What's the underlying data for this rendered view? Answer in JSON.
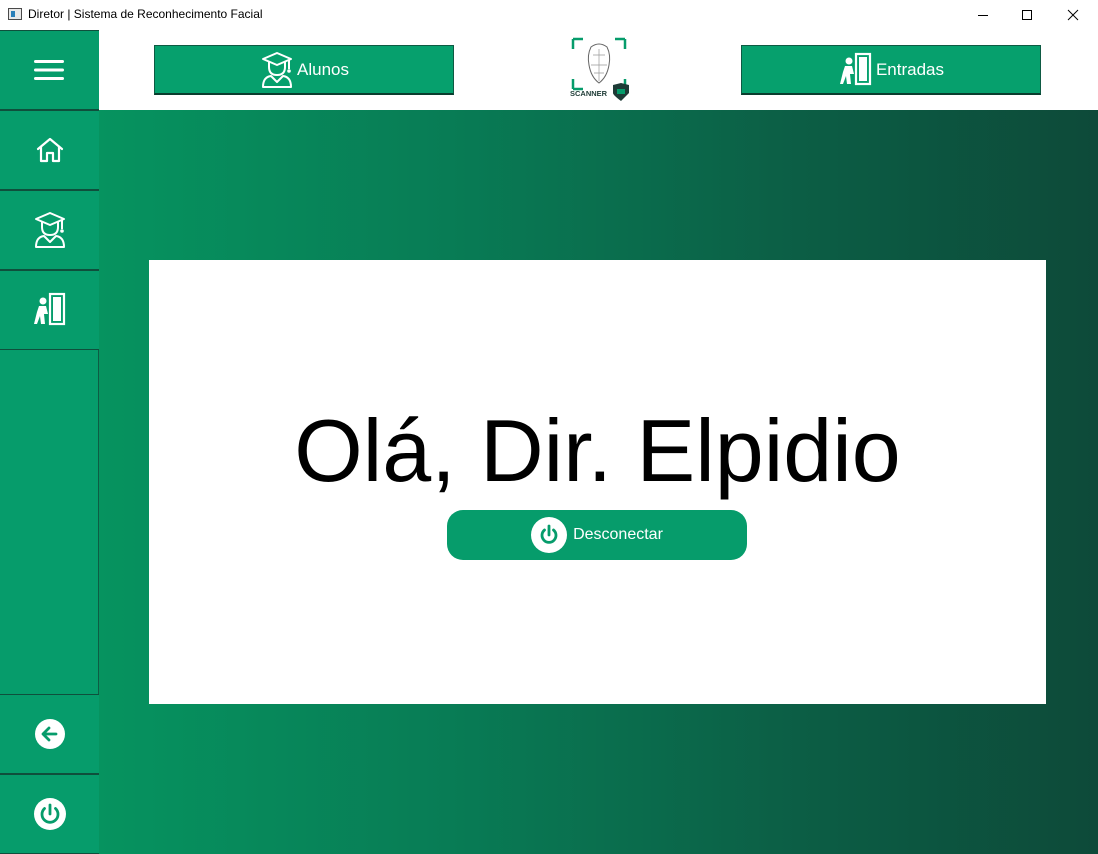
{
  "window": {
    "title": "Diretor | Sistema de Reconhecimento Facial"
  },
  "header": {
    "alunos_label": "Alunos",
    "entradas_label": "Entradas",
    "logo_text": "SCANNER"
  },
  "main": {
    "greeting": "Olá, Dir. Elpidio",
    "logout_label": "Desconectar"
  },
  "sidebar": {
    "items": [
      {
        "icon": "hamburger-menu-icon"
      },
      {
        "icon": "home-icon"
      },
      {
        "icon": "graduate-student-icon"
      },
      {
        "icon": "person-entering-door-icon"
      },
      {
        "icon": "back-arrow-icon"
      },
      {
        "icon": "power-icon"
      }
    ]
  },
  "colors": {
    "accent": "#069c6b",
    "gradient_start": "#06935f",
    "gradient_end": "#0d4a39",
    "card": "#ffffff"
  }
}
